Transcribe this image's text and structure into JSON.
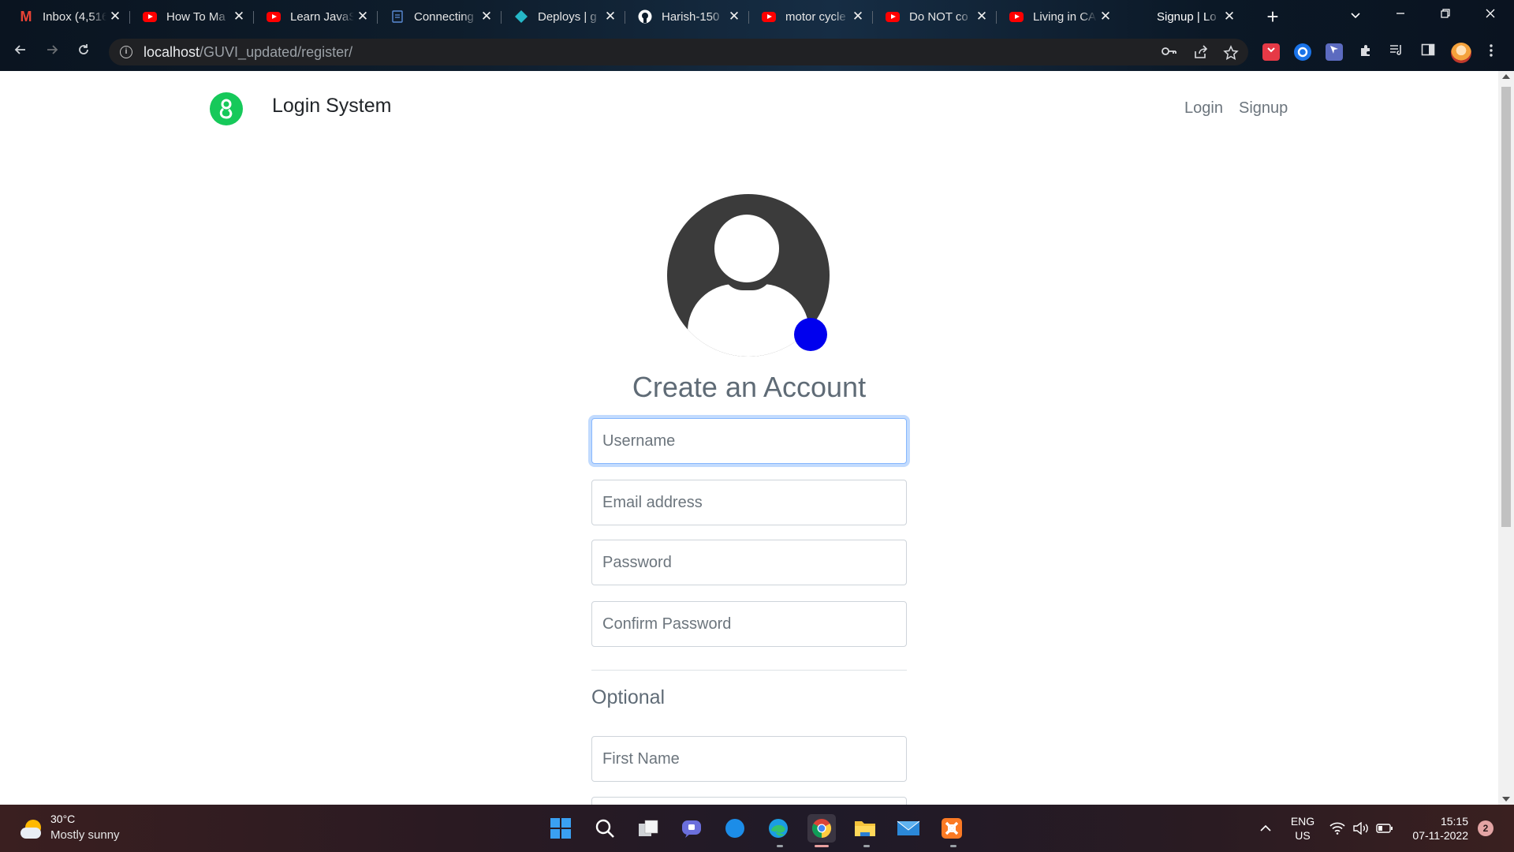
{
  "browser": {
    "tabs": [
      {
        "title": "Inbox (4,516",
        "icon": "gmail-icon"
      },
      {
        "title": "How To Ma",
        "icon": "youtube-icon"
      },
      {
        "title": "Learn JavaS",
        "icon": "youtube-icon"
      },
      {
        "title": "Connecting",
        "icon": "document-icon"
      },
      {
        "title": "Deploys | g",
        "icon": "netlify-icon"
      },
      {
        "title": "Harish-150",
        "icon": "github-icon"
      },
      {
        "title": "motor cycle",
        "icon": "youtube-icon"
      },
      {
        "title": "Do NOT co",
        "icon": "youtube-icon"
      },
      {
        "title": "Living in CA",
        "icon": "youtube-icon"
      },
      {
        "title": "Signup | Lo",
        "icon": "none"
      }
    ],
    "close_glyph": "✕",
    "new_tab_glyph": "+",
    "address": {
      "host": "localhost",
      "path": "/GUVI_updated/register/"
    }
  },
  "page": {
    "brand": "Login System",
    "nav": {
      "login": "Login",
      "signup": "Signup"
    },
    "heading": "Create an Account",
    "fields": {
      "username": "Username",
      "email": "Email address",
      "password": "Password",
      "confirm_password": "Confirm Password",
      "first_name": "First Name"
    },
    "optional_label": "Optional"
  },
  "taskbar": {
    "weather": {
      "temp": "30°C",
      "condition": "Mostly sunny"
    },
    "language": {
      "line1": "ENG",
      "line2": "US"
    },
    "clock": {
      "time": "15:15",
      "date": "07-11-2022"
    },
    "notifications": "2"
  },
  "colors": {
    "brand_green": "#16c95a",
    "edit_dot": "#0000ee",
    "focus_ring": "#86b7fe",
    "avatar_gray": "#3b3b3b"
  }
}
